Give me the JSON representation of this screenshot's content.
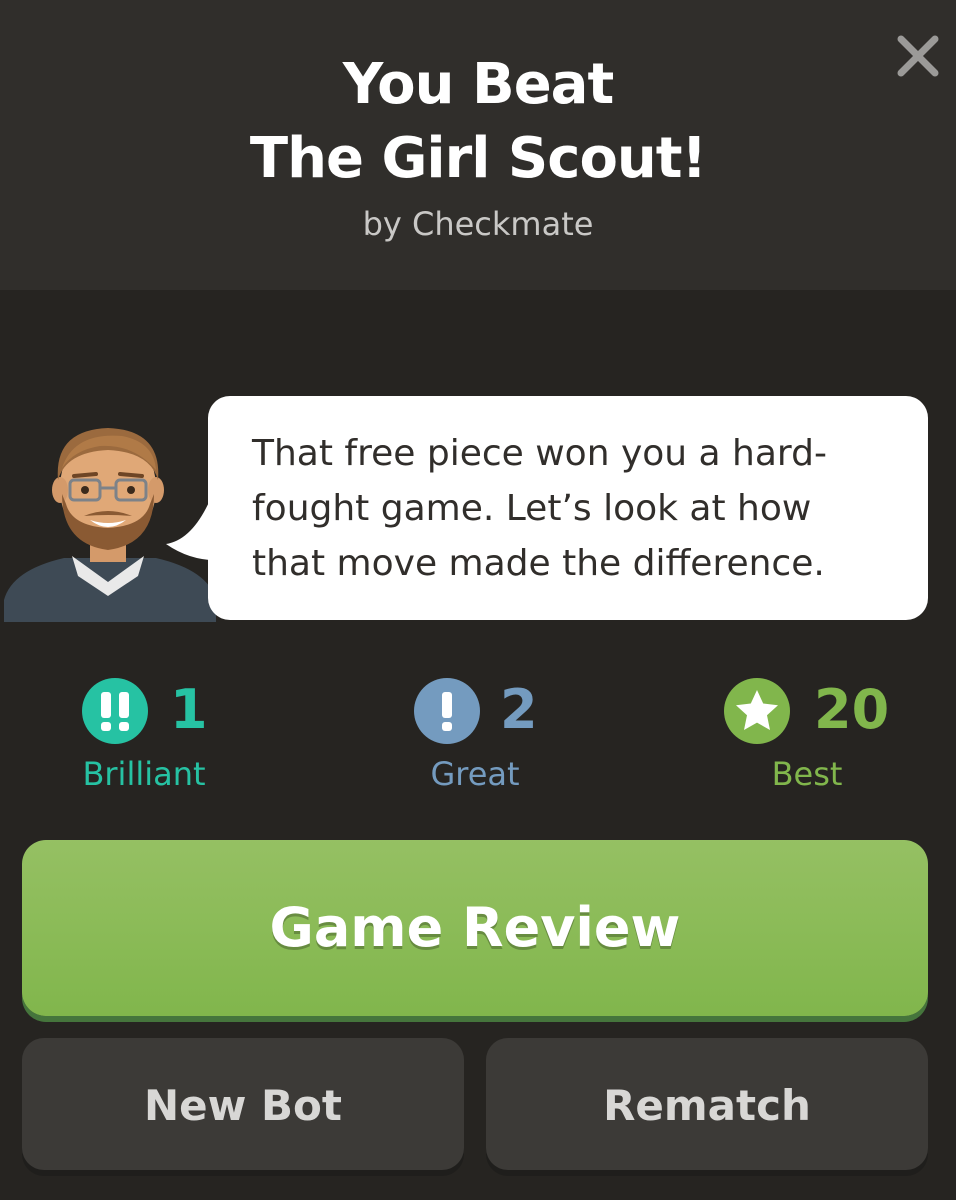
{
  "header": {
    "title_line1": "You Beat",
    "title_line2": "The Girl Scout!",
    "subtitle": "by Checkmate",
    "close_icon": "close-icon"
  },
  "coach": {
    "avatar_icon": "coach-avatar",
    "message_line1": "That free piece won you a hard-",
    "message_line2": "fought game. Let’s look at how",
    "message_line3": "that move made the difference."
  },
  "stats": {
    "brilliant": {
      "count": "1",
      "label": "Brilliant",
      "icon": "brilliant-icon",
      "color": "#26c2a3"
    },
    "great": {
      "count": "2",
      "label": "Great",
      "icon": "great-icon",
      "color": "#749bbf"
    },
    "best": {
      "count": "20",
      "label": "Best",
      "icon": "best-icon",
      "color": "#81b64c"
    }
  },
  "actions": {
    "game_review_label": "Game Review",
    "new_bot_label": "New Bot",
    "rematch_label": "Rematch"
  },
  "colors": {
    "background": "#262421",
    "header_background": "#302e2b",
    "accent_green": "#81b64c",
    "secondary_button": "#3c3a37"
  }
}
